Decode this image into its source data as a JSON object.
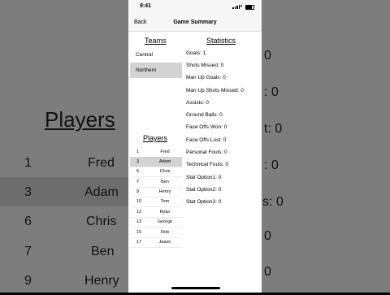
{
  "background": {
    "title": "Players",
    "rows": [
      {
        "num": "1",
        "name": "Fred"
      },
      {
        "num": "3",
        "name": "Adam"
      },
      {
        "num": "6",
        "name": "Chris"
      },
      {
        "num": "7",
        "name": "Ben"
      },
      {
        "num": "9",
        "name": "Henry"
      }
    ],
    "right_values": [
      "0",
      ": 0",
      "t: 0",
      ": 0",
      "0",
      "s: 0",
      "0",
      "0",
      "0"
    ]
  },
  "status_bar": {
    "time": "9:41"
  },
  "nav": {
    "back_label": "Back",
    "title": "Game Summary"
  },
  "teams": {
    "title": "Teams",
    "items": [
      {
        "label": "Central",
        "selected": false
      },
      {
        "label": "Northern",
        "selected": true
      }
    ]
  },
  "statistics": {
    "title": "Statistics",
    "items": [
      "Goals: 1",
      "Shots Missed: 0",
      "Man Up Goals: 0",
      "Man Up Shots Missed: 0",
      "Assists: 0",
      "Ground Balls: 0",
      "Face Offs Won: 0",
      "Face Offs Lost: 0",
      "Personal Fouls: 0",
      "Technical Fouls: 0",
      "Stat Option1: 0",
      "Stat Option2: 0",
      "Stat Option3: 0"
    ]
  },
  "players": {
    "title": "Players",
    "items": [
      {
        "num": "1",
        "name": "Fred",
        "selected": false
      },
      {
        "num": "3",
        "name": "Adam",
        "selected": true
      },
      {
        "num": "6",
        "name": "Chris",
        "selected": false
      },
      {
        "num": "7",
        "name": "Ben",
        "selected": false
      },
      {
        "num": "9",
        "name": "Henry",
        "selected": false
      },
      {
        "num": "10",
        "name": "Tom",
        "selected": false
      },
      {
        "num": "12",
        "name": "Ryan",
        "selected": false
      },
      {
        "num": "13",
        "name": "George",
        "selected": false
      },
      {
        "num": "15",
        "name": "Rob",
        "selected": false
      },
      {
        "num": "17",
        "name": "Jason",
        "selected": false
      }
    ]
  }
}
